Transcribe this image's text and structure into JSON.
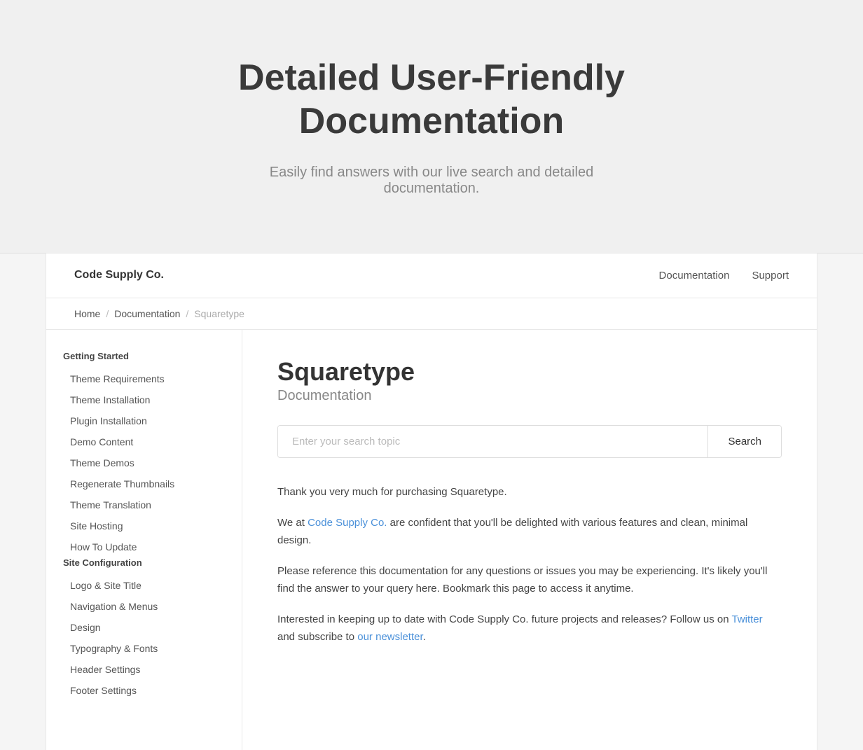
{
  "hero": {
    "title": "Detailed User-Friendly Documentation",
    "subtitle": "Easily find answers with our live search and detailed documentation."
  },
  "navbar": {
    "brand": "Code Supply Co.",
    "links": [
      {
        "label": "Documentation",
        "href": "#"
      },
      {
        "label": "Support",
        "href": "#"
      }
    ]
  },
  "breadcrumb": {
    "items": [
      {
        "label": "Home",
        "href": "#"
      },
      {
        "label": "Documentation",
        "href": "#"
      },
      {
        "label": "Squaretype",
        "href": "#",
        "current": true
      }
    ]
  },
  "sidebar": {
    "sections": [
      {
        "title": "Getting Started",
        "links": [
          "Theme Requirements",
          "Theme Installation",
          "Plugin Installation",
          "Demo Content",
          "Theme Demos",
          "Regenerate Thumbnails",
          "Theme Translation",
          "Site Hosting",
          "How To Update"
        ]
      },
      {
        "title": "Site Configuration",
        "links": [
          "Logo & Site Title",
          "Navigation & Menus",
          "Design",
          "Typography & Fonts",
          "Header Settings",
          "Footer Settings"
        ]
      }
    ]
  },
  "main": {
    "title": "Squaretype",
    "subtitle": "Documentation",
    "search_placeholder": "Enter your search topic",
    "search_button": "Search",
    "body_paragraphs": [
      "Thank you very much for purchasing Squaretype.",
      "We at Code Supply Co. are confident that you'll be delighted with various features and clean, minimal design.",
      "Please reference this documentation for any questions or issues you may be experiencing. It's likely you'll find the answer to your query here. Bookmark this page to access it anytime.",
      "Interested in keeping up to date with Code Supply Co. future projects and releases? Follow us on Twitter and subscribe to our newsletter."
    ],
    "code_supply_link": "Code Supply Co.",
    "twitter_link": "Twitter",
    "newsletter_link": "our newsletter"
  }
}
